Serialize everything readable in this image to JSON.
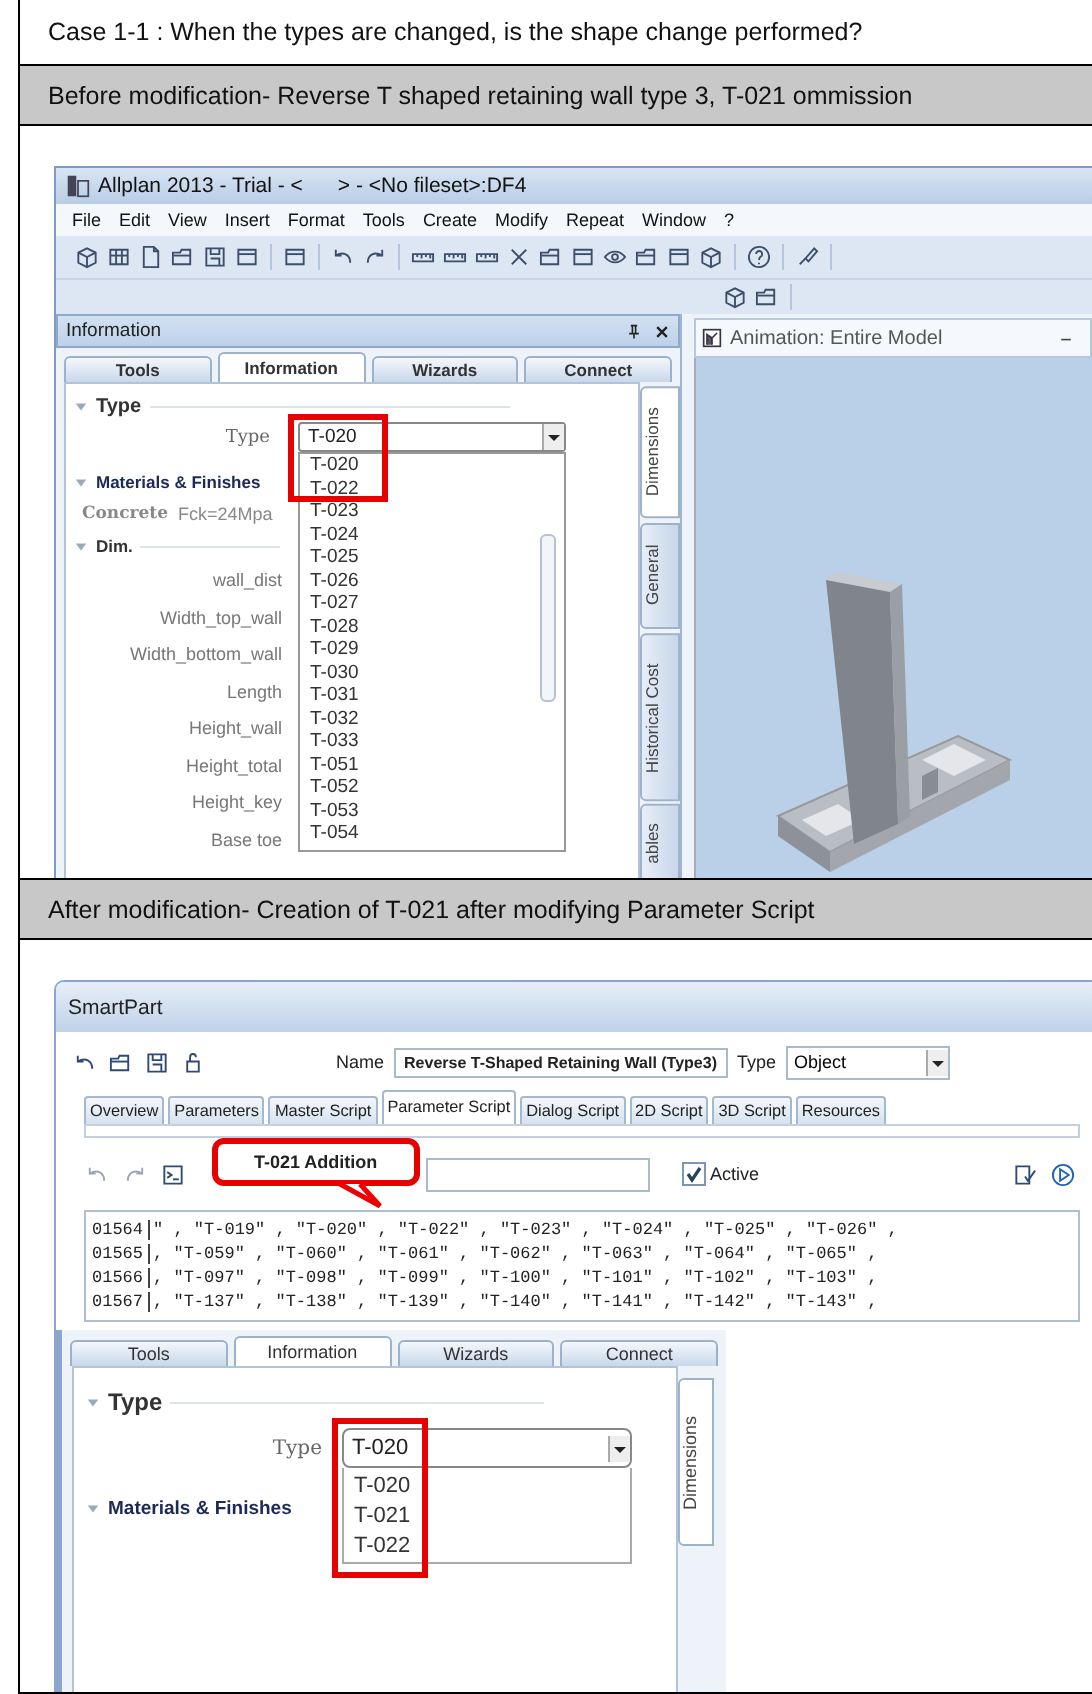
{
  "heading": "Case 1-1 : When the types are changed, is the shape change performed?",
  "before": {
    "caption": "Before modification- Reverse T shaped retaining wall type 3, T-021 ommission",
    "window_title": "Allplan 2013 - Trial - <      > - <No fileset>:DF4",
    "menu": [
      "File",
      "Edit",
      "View",
      "Insert",
      "Format",
      "Tools",
      "Create",
      "Modify",
      "Repeat",
      "Window",
      "?"
    ],
    "panel": {
      "title": "Information",
      "tabs": [
        {
          "label": "Tools",
          "selected": false
        },
        {
          "label": "Information",
          "selected": true
        },
        {
          "label": "Wizards",
          "selected": false
        },
        {
          "label": "Connect",
          "selected": false
        }
      ],
      "side_tabs": [
        {
          "label": "Dimensions",
          "selected": true
        },
        {
          "label": "General",
          "selected": false
        },
        {
          "label": "Historical Cost",
          "selected": false
        },
        {
          "label": "ables",
          "selected": false
        }
      ],
      "type_heading": "Type",
      "type_label": "Type",
      "type_value": "T-020",
      "options": [
        "T-020",
        "T-022",
        "T-023",
        "T-024",
        "T-025",
        "T-026",
        "T-027",
        "T-028",
        "T-029",
        "T-030",
        "T-031",
        "T-032",
        "T-033",
        "T-051",
        "T-052",
        "T-053",
        "T-054"
      ],
      "materials_heading": "Materials & Finishes",
      "concrete_label": "Concrete",
      "concrete_value": "Fck=24Mpa",
      "dim_heading": "Dim.",
      "dim_labels": [
        "wall_dist",
        "Width_top_wall",
        "Width_bottom_wall",
        "Length",
        "Height_wall",
        "Height_total",
        "Height_key",
        "Base toe"
      ]
    },
    "viewport_title": "Animation: Entire Model"
  },
  "after": {
    "caption": "After modification- Creation of T-021 after modifying Parameter Script",
    "window_title": "SmartPart",
    "name_label": "Name",
    "name_value": "Reverse T-Shaped Retaining Wall (Type3)",
    "type_label": "Type",
    "type_value": "Object",
    "tabs": [
      {
        "label": "Overview",
        "selected": false
      },
      {
        "label": "Parameters",
        "selected": false
      },
      {
        "label": "Master Script",
        "selected": false
      },
      {
        "label": "Parameter Script",
        "selected": true
      },
      {
        "label": "Dialog Script",
        "selected": false
      },
      {
        "label": "2D Script",
        "selected": false
      },
      {
        "label": "3D Script",
        "selected": false
      },
      {
        "label": "Resources",
        "selected": false
      }
    ],
    "callout": "T-021 Addition",
    "active": {
      "label": "Active",
      "checked": true
    },
    "code_lines": [
      {
        "number": "01564",
        "text": "\" , \"T-019\" , \"T-020\" , \"T-022\" , \"T-023\" , \"T-024\" , \"T-025\" , \"T-026\" ,"
      },
      {
        "number": "01565",
        "text": ", \"T-059\" , \"T-060\" , \"T-061\" , \"T-062\" , \"T-063\" , \"T-064\" , \"T-065\" ,"
      },
      {
        "number": "01566",
        "text": ", \"T-097\" , \"T-098\" , \"T-099\" , \"T-100\" , \"T-101\" , \"T-102\" , \"T-103\" ,"
      },
      {
        "number": "01567",
        "text": ", \"T-137\" , \"T-138\" , \"T-139\" , \"T-140\" , \"T-141\" , \"T-142\" , \"T-143\" ,"
      }
    ],
    "panel": {
      "tabs": [
        {
          "label": "Tools",
          "selected": false
        },
        {
          "label": "Information",
          "selected": true
        },
        {
          "label": "Wizards",
          "selected": false
        },
        {
          "label": "Connect",
          "selected": false
        }
      ],
      "side_tabs": [
        {
          "label": "Dimensions",
          "selected": true
        }
      ],
      "type_heading": "Type",
      "type_label": "Type",
      "type_value": "T-020",
      "options": [
        "T-020",
        "T-021",
        "T-022"
      ],
      "materials_heading": "Materials & Finishes"
    }
  }
}
